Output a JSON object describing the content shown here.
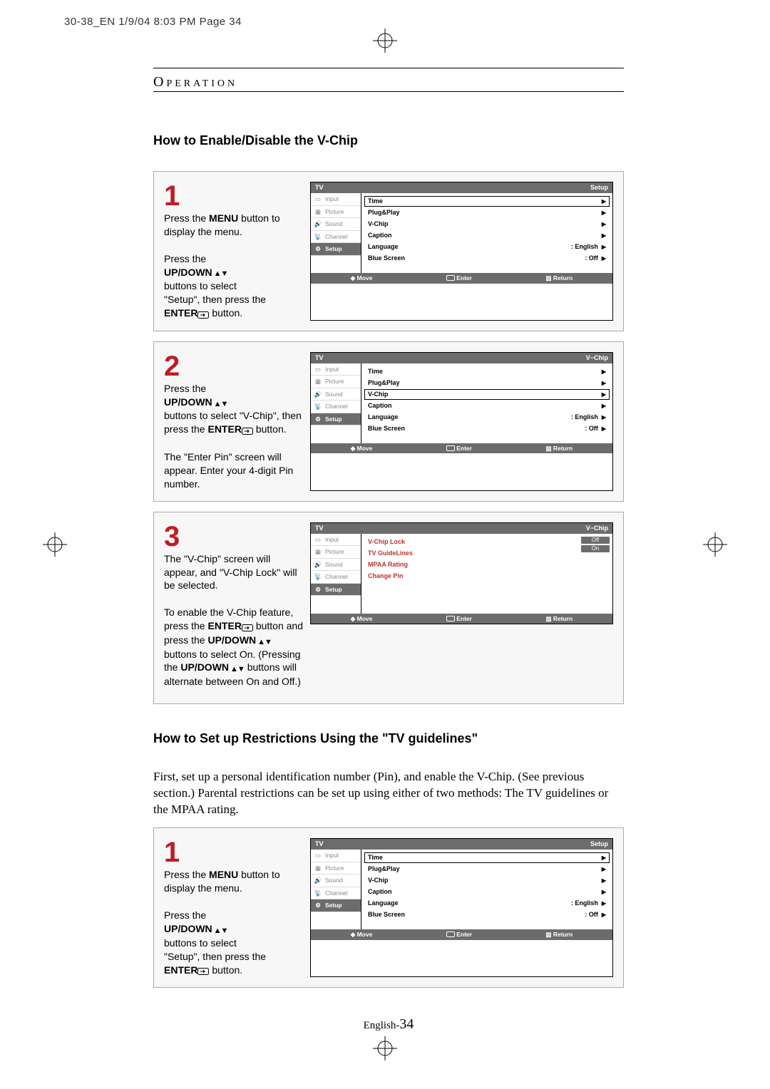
{
  "meta": {
    "header_line": "30-38_EN  1/9/04 8:03 PM  Page 34"
  },
  "labels": {
    "section": "Operation",
    "h_enable": "How to Enable/Disable the V-Chip",
    "h_tvguide": "How to Set up Restrictions Using the \"TV guidelines\"",
    "intro_para": "First, set up a personal identification number (Pin), and enable the V-Chip. (See previous section.) Parental restrictions can be set up using either of two methods: The TV guidelines or the MPAA rating.",
    "page_label": "English-",
    "page_num": "34"
  },
  "tokens": {
    "press_the": "Press the ",
    "menu": "MENU",
    "btn_to_display": " button to display the menu.",
    "updown": "UP/DOWN",
    "buttons_to_select": " buttons to select",
    "setup_then": "\"Setup\", then press the",
    "enter": "ENTER",
    "button_dot": "  button.",
    "step2_a": "Press the",
    "step2_b": " buttons to select \"V-Chip\", then press the ",
    "step2_c": " button.",
    "step2_d": "The \"Enter Pin\" screen will appear. Enter your 4-digit Pin number.",
    "step3_a": "The \"V-Chip\" screen will appear, and \"V-Chip Lock\" will be selected.",
    "step3_b": "To enable the V-Chip feature, press the ",
    "step3_c": " button and press the ",
    "step3_d": " buttons to select On. (Pressing the ",
    "step3_e": " buttons will alternate between On and Off.)"
  },
  "osd": {
    "tv": "TV",
    "setup": "Setup",
    "vchip": "V−Chip",
    "side": {
      "input": "Input",
      "picture": "Picture",
      "sound": "Sound",
      "channel": "Channel",
      "setup_item": "Setup"
    },
    "rows_setup": {
      "time": "Time",
      "plugplay": "Plug&Play",
      "vchip": "V-Chip",
      "caption": "Caption",
      "language": "Language",
      "language_val": ":   English",
      "blue": "Blue Screen",
      "blue_val": ":   Off"
    },
    "rows_vchip": {
      "lock": "V-Chip Lock",
      "guidelines": "TV GuideLines",
      "mpaa": "MPAA Rating",
      "change": "Change Pin",
      "off": "Off",
      "on": "On"
    },
    "foot": {
      "move": "Move",
      "enter": "Enter",
      "return": "Return"
    }
  }
}
